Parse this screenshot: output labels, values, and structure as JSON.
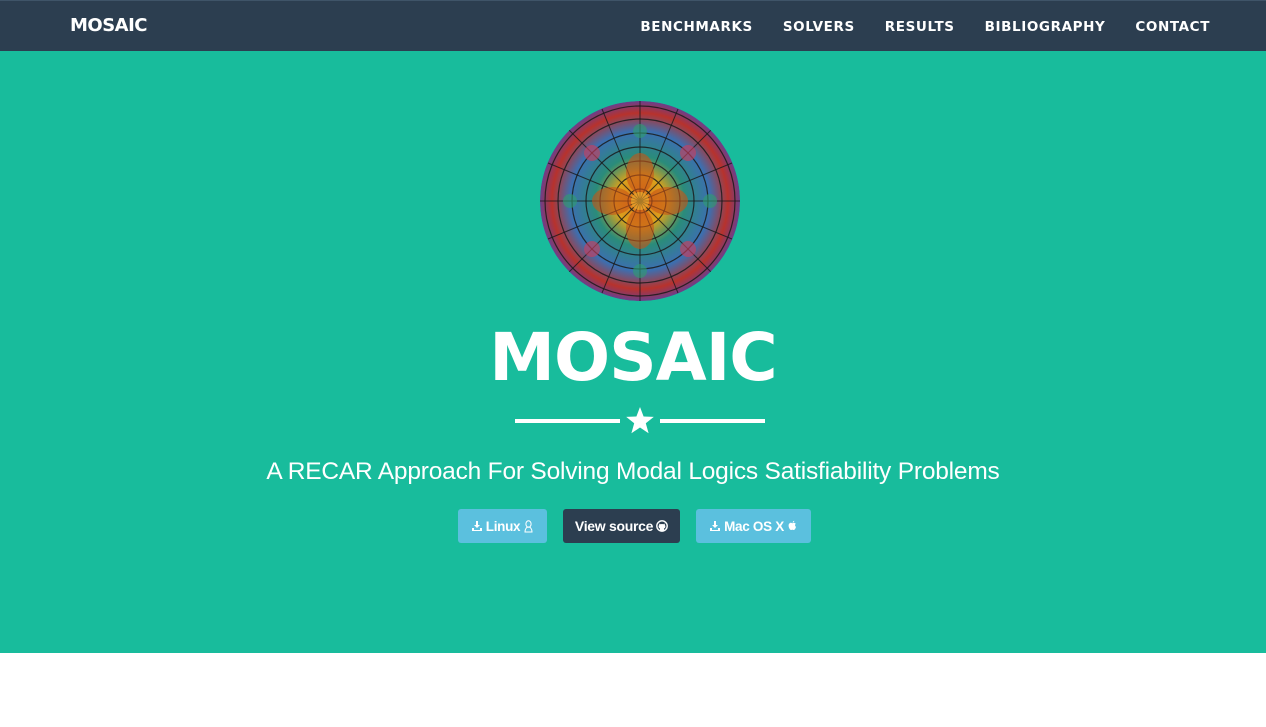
{
  "navbar": {
    "brand": "MOSAIC",
    "links": [
      {
        "label": "BENCHMARKS"
      },
      {
        "label": "SOLVERS"
      },
      {
        "label": "RESULTS"
      },
      {
        "label": "BIBLIOGRAPHY"
      },
      {
        "label": "CONTACT"
      }
    ]
  },
  "hero": {
    "title": "MOSAIC",
    "divider_icon": "star-icon",
    "subtitle": "A RECAR Approach For Solving Modal Logics Satisfiability Problems",
    "buttons": {
      "linux": {
        "label": "Linux",
        "icons": [
          "download-icon",
          "linux-icon"
        ]
      },
      "source": {
        "label": "View source",
        "icons": [
          "github-icon"
        ]
      },
      "mac": {
        "label": "Mac OS X",
        "icons": [
          "download-icon",
          "apple-icon"
        ]
      }
    }
  },
  "colors": {
    "navbar_bg": "#2c3e50",
    "hero_bg": "#18bc9c",
    "button_info": "#5bc0de",
    "button_dark": "#2c3e50",
    "text": "#ffffff"
  }
}
